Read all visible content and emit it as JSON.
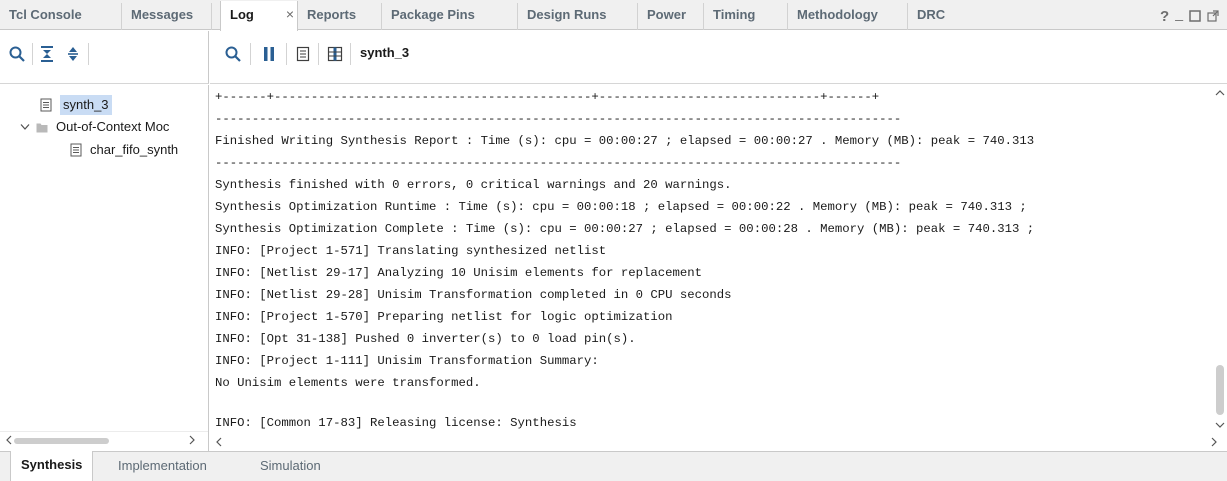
{
  "top_tabs": [
    {
      "label": "Tcl Console"
    },
    {
      "label": "Messages"
    },
    {
      "label": "Log"
    },
    {
      "label": "Reports"
    },
    {
      "label": "Package Pins"
    },
    {
      "label": "Design Runs"
    },
    {
      "label": "Power"
    },
    {
      "label": "Timing"
    },
    {
      "label": "Methodology"
    },
    {
      "label": "DRC"
    }
  ],
  "tab_close_glyph": "×",
  "window_controls": {
    "help": "?",
    "minimize": "_"
  },
  "toolbar": {
    "left_icons": [
      "search-icon",
      "collapse-all-icon",
      "expand-all-icon"
    ],
    "right_icons": [
      "search-icon",
      "pause-icon",
      "document-icon",
      "table-icon"
    ],
    "run_label": "synth_3"
  },
  "tree": {
    "items": [
      {
        "label": "synth_3",
        "icon": "document-icon",
        "selected": true
      },
      {
        "label": "Out-of-Context Moc",
        "icon": "folder-icon",
        "expanded": true
      },
      {
        "label": "char_fifo_synth",
        "icon": "document-icon"
      }
    ]
  },
  "log": {
    "lines": [
      "+------+-------------------------------------------+------------------------------+------+",
      "---------------------------------------------------------------------------------------------",
      "Finished Writing Synthesis Report : Time (s): cpu = 00:00:27 ; elapsed = 00:00:27 . Memory (MB): peak = 740.313",
      "---------------------------------------------------------------------------------------------",
      "Synthesis finished with 0 errors, 0 critical warnings and 20 warnings.",
      "Synthesis Optimization Runtime : Time (s): cpu = 00:00:18 ; elapsed = 00:00:22 . Memory (MB): peak = 740.313 ;",
      "Synthesis Optimization Complete : Time (s): cpu = 00:00:27 ; elapsed = 00:00:28 . Memory (MB): peak = 740.313 ;",
      "INFO: [Project 1-571] Translating synthesized netlist",
      "INFO: [Netlist 29-17] Analyzing 10 Unisim elements for replacement",
      "INFO: [Netlist 29-28] Unisim Transformation completed in 0 CPU seconds",
      "INFO: [Project 1-570] Preparing netlist for logic optimization",
      "INFO: [Opt 31-138] Pushed 0 inverter(s) to 0 load pin(s).",
      "INFO: [Project 1-111] Unisim Transformation Summary:",
      "No Unisim elements were transformed.",
      "",
      "INFO: [Common 17-83] Releasing license: Synthesis"
    ]
  },
  "bottom_tabs": [
    {
      "label": "Synthesis",
      "active": true
    },
    {
      "label": "Implementation"
    },
    {
      "label": "Simulation"
    }
  ],
  "colors": {
    "accent_selection": "#c9dcf4",
    "tab_text": "#5d6a75",
    "icon_blue": "#2a6aa8"
  }
}
